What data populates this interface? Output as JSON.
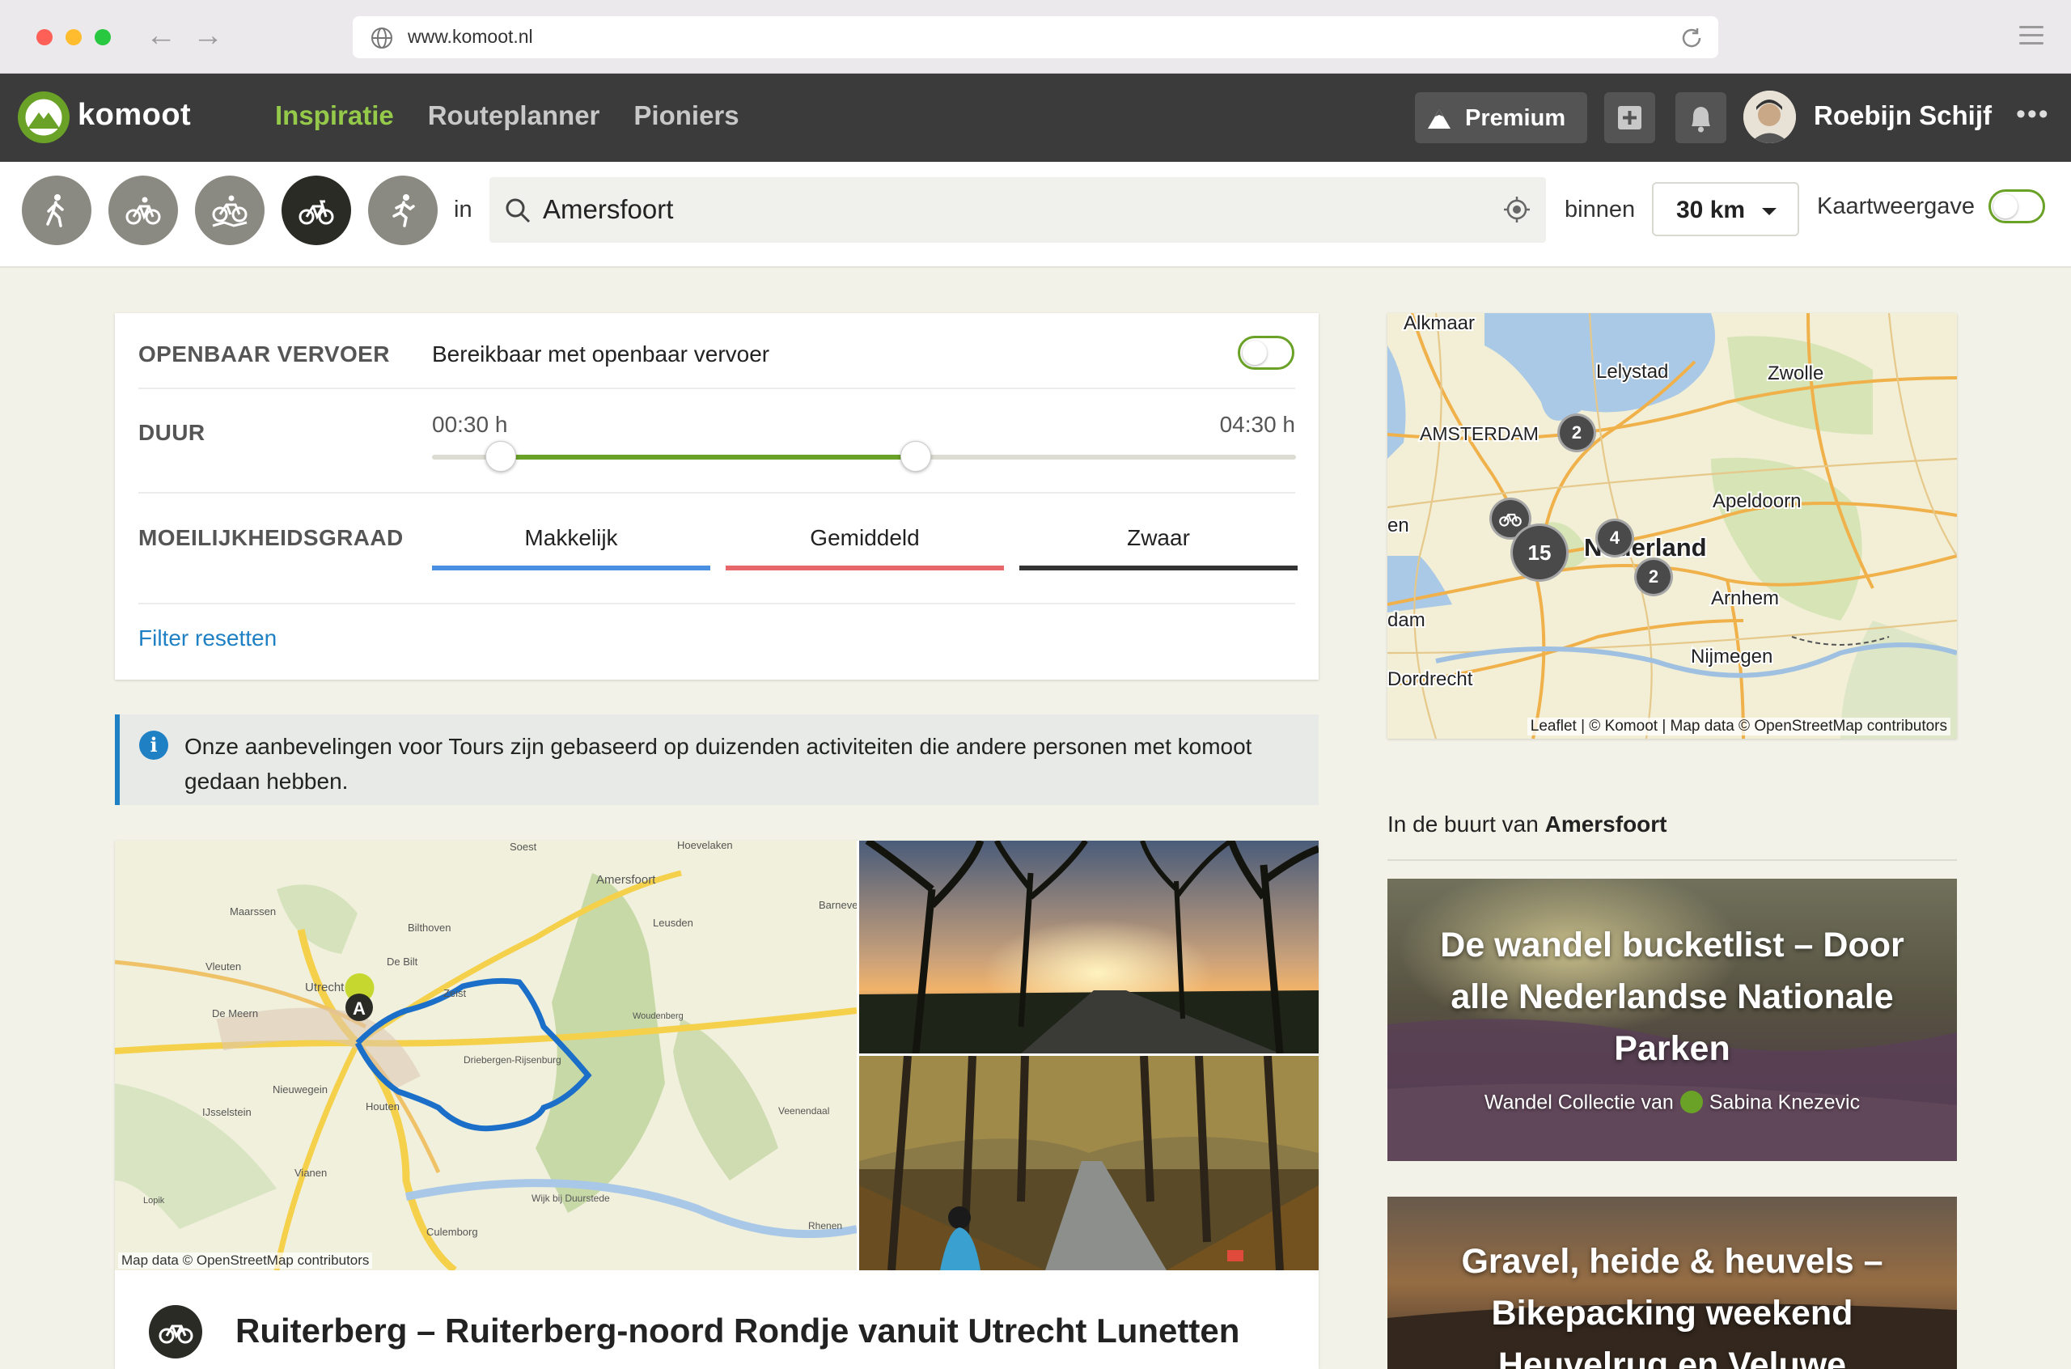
{
  "browser": {
    "url": "www.komoot.nl"
  },
  "header": {
    "brand": "komoot",
    "nav": [
      {
        "label": "Inspiratie",
        "active": true
      },
      {
        "label": "Routeplanner",
        "active": false
      },
      {
        "label": "Pioniers",
        "active": false
      }
    ],
    "premium_label": "Premium",
    "user_name": "Roebijn Schijf",
    "more_label": "•••"
  },
  "filterbar": {
    "sports": [
      "hike-icon",
      "bike-icon",
      "mtb-icon",
      "roadbike-icon",
      "run-icon"
    ],
    "selected_sport": "roadbike-icon",
    "in_label": "in",
    "search_value": "Amersfoort",
    "within_label": "binnen",
    "range_value": "30 km",
    "map_view_label": "Kaartweergave"
  },
  "filters": {
    "transit_label": "OPENBAAR VERVOER",
    "transit_text": "Bereikbaar met openbaar vervoer",
    "duration_label": "DUUR",
    "duration_min": "00:30 h",
    "duration_max": "04:30 h",
    "duration_range_fraction": [
      0.08,
      0.56
    ],
    "difficulty_label": "MOEILIJKHEIDSGRAAD",
    "difficulties": [
      {
        "label": "Makkelijk",
        "color": "#4a90e2"
      },
      {
        "label": "Gemiddeld",
        "color": "#e8676b"
      },
      {
        "label": "Zwaar",
        "color": "#333333"
      }
    ],
    "reset_label": "Filter resetten"
  },
  "info": {
    "text": "Onze aanbevelingen voor Tours zijn gebaseerd op duizenden activiteiten die andere personen met komoot gedaan hebben."
  },
  "tour": {
    "title": "Ruiterberg – Ruiterberg-noord Rondje vanuit Utrecht Lunetten",
    "start_marker": "A",
    "map_attribution": "Map data © OpenStreetMap contributors",
    "map_places": [
      "Soest",
      "Hoevelaken",
      "Amersfoort",
      "Barneve",
      "Maarssen",
      "Bilthoven",
      "Leusden",
      "Vleuten",
      "Utrecht",
      "De Bilt",
      "Zeist",
      "De Meern",
      "Woudenberg",
      "Driebergen-Rijsenburg",
      "Nieuwegein",
      "Houten",
      "IJsselstein",
      "Veenendaal",
      "Vianen",
      "Lopik",
      "Wijk bij Duurstede",
      "Culemborg",
      "Rhenen"
    ]
  },
  "side_map": {
    "places": [
      "Alkmaar",
      "Lelystad",
      "Zwolle",
      "AMSTERDAM",
      "Apeldoorn",
      "Nederland",
      "Arnhem",
      "Nijmegen",
      "Dordrecht",
      "en",
      "dam"
    ],
    "clusters": [
      "2",
      "4",
      "15",
      "2"
    ],
    "attribution": "Leaflet | © Komoot | Map data © OpenStreetMap contributors"
  },
  "nearby": {
    "prefix": "In de buurt van",
    "place": "Amersfoort"
  },
  "collections": [
    {
      "title": "De wandel bucketlist – Door alle Nederlandse Nationale Parken",
      "by_prefix": "Wandel Collectie van",
      "author": "Sabina Knezevic"
    },
    {
      "title": "Gravel, heide & heuvels – Bikepacking weekend Heuvelrug en Veluwe",
      "by_prefix": "",
      "author": ""
    }
  ]
}
